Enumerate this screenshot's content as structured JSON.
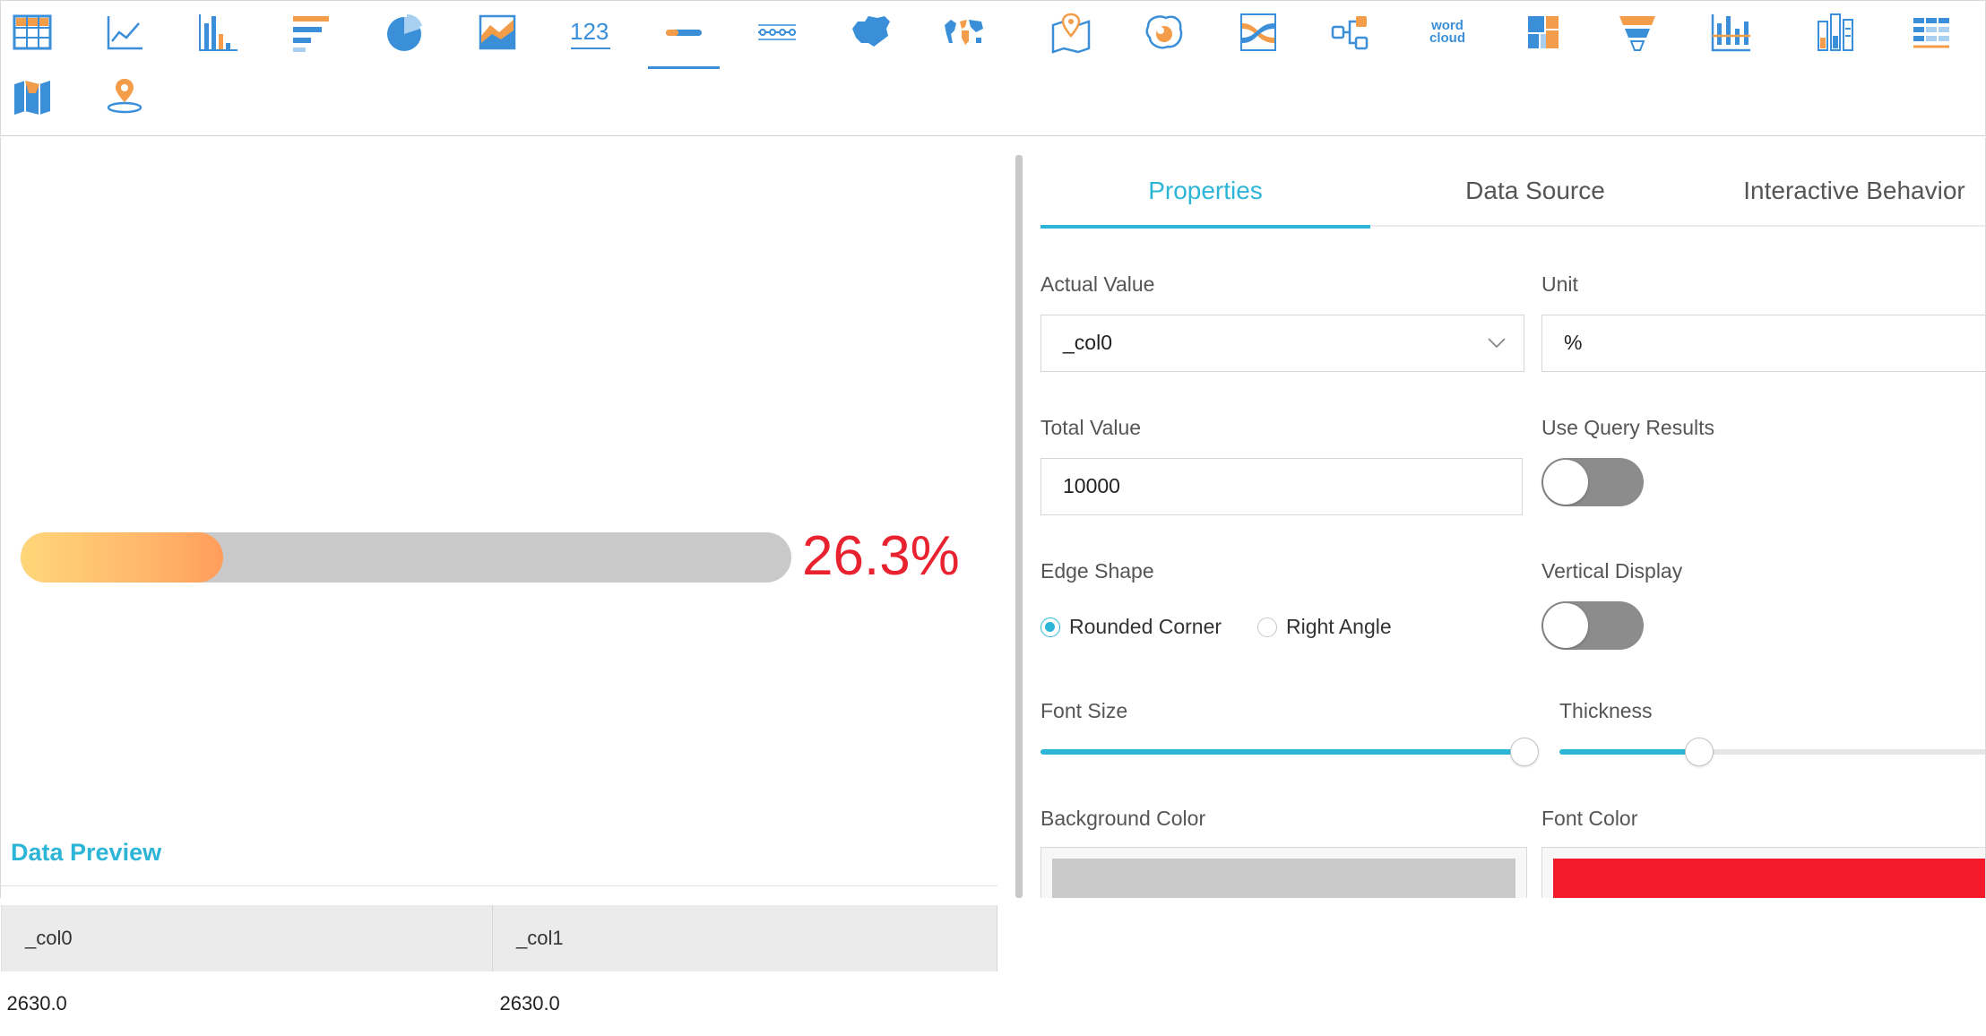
{
  "toolbar": {
    "active_tool": "progress-bar",
    "tools": [
      "table",
      "line-chart",
      "column-chart",
      "bar-chart",
      "pie-chart",
      "area-chart",
      "number-kpi",
      "progress-bar",
      "timeline",
      "china-map",
      "world-map",
      "location-map",
      "bubble-map",
      "sankey",
      "tree",
      "word-cloud",
      "treemap",
      "funnel",
      "column-range",
      "stacked-column",
      "cross-table",
      "flow-map",
      "poi-map"
    ],
    "word_cloud_label_1": "word",
    "word_cloud_label_2": "cloud",
    "kpi_digits": "123"
  },
  "preview": {
    "progress_percent": 26.3,
    "value_text": "26.3%",
    "colors": {
      "fill_start": "#ffd67a",
      "fill_end": "#ff9d5c",
      "track": "#c9c9c9",
      "value": "#e8232f"
    }
  },
  "data_preview": {
    "title": "Data Preview",
    "columns": [
      "_col0",
      "_col1"
    ],
    "rows": [
      [
        "2630.0",
        "2630.0"
      ]
    ]
  },
  "panel": {
    "tabs": [
      "Properties",
      "Data Source",
      "Interactive Behavior"
    ],
    "active_tab": "Properties",
    "actual_value": {
      "label": "Actual Value",
      "value": "_col0"
    },
    "unit": {
      "label": "Unit",
      "value": "%"
    },
    "total_value": {
      "label": "Total Value",
      "value": "10000"
    },
    "use_query_results": {
      "label": "Use Query Results",
      "on": false
    },
    "edge_shape": {
      "label": "Edge Shape",
      "options": [
        "Rounded Corner",
        "Right Angle"
      ],
      "selected": "Rounded Corner"
    },
    "vertical_display": {
      "label": "Vertical Display",
      "on": false
    },
    "font_size": {
      "label": "Font Size",
      "level": 1.0
    },
    "thickness": {
      "label": "Thickness",
      "level": 0.3
    },
    "background_color": {
      "label": "Background Color",
      "value": "#c9c9c9"
    },
    "font_color": {
      "label": "Font Color",
      "value": "#f31b2b"
    },
    "accent": "#2cb5d6"
  }
}
